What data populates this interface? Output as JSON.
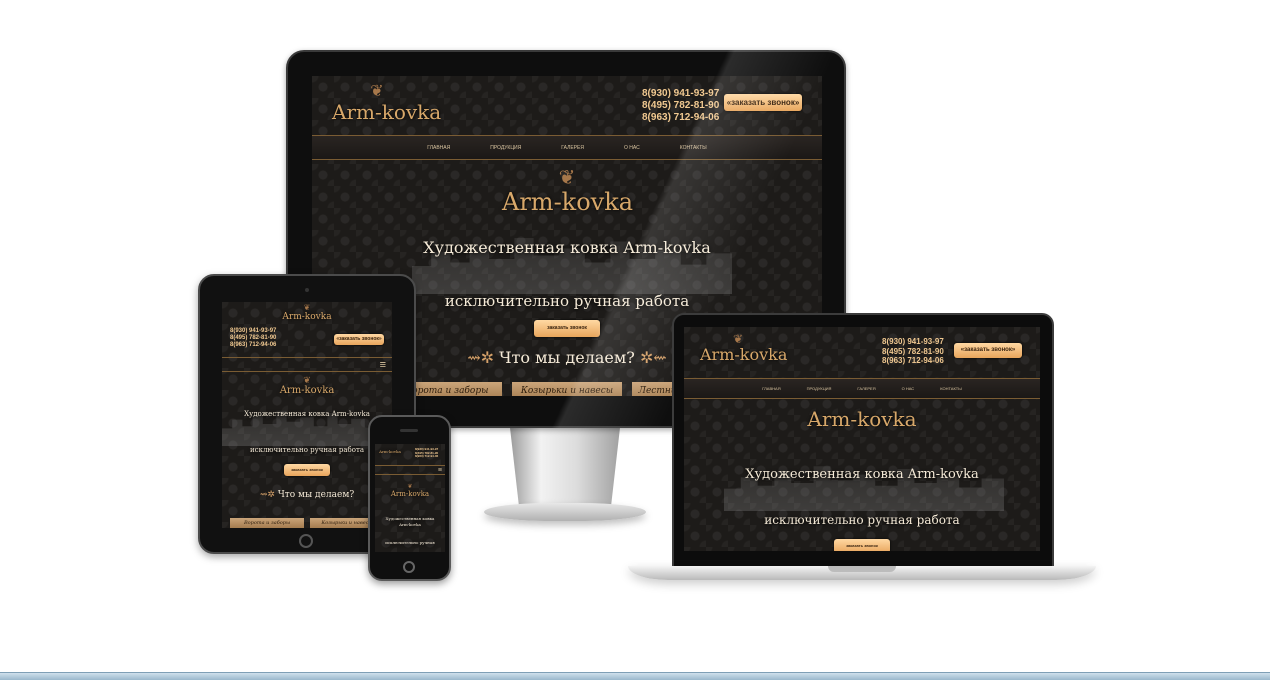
{
  "site": {
    "logo": "Arm-kovka",
    "logo_ornament": "❦",
    "phones": [
      "8(930) 941-93-97",
      "8(495) 782-81-90",
      "8(963) 712-94-06"
    ],
    "cta": "«заказать звонок»",
    "cta_small": "заказать звонок",
    "nav": [
      "главная",
      "продукция",
      "галерея",
      "о нас",
      "контакты"
    ],
    "hero_title": "Художественная ковка Arm-kovka",
    "hero_title_phone": [
      "Художественная ковка",
      "Arm-kovka"
    ],
    "hero_sub": "исключительно ручная работа",
    "hero_sub_phone": "исключительно ручная",
    "section_title": "Что мы делаем?",
    "tabs": [
      "Ворота и заборы",
      "Козырьки и навесы",
      "Лестницы и перила"
    ],
    "tablet_tabs": [
      "Ворота и заборы",
      "Козырьки и навесы"
    ],
    "ornament": "⇝✲",
    "ornament_right": "✲⇜",
    "menu_icon": "≡"
  },
  "colors": {
    "accent": "#e8a55c",
    "background": "#1d1b19",
    "text": "#f5ead7"
  }
}
